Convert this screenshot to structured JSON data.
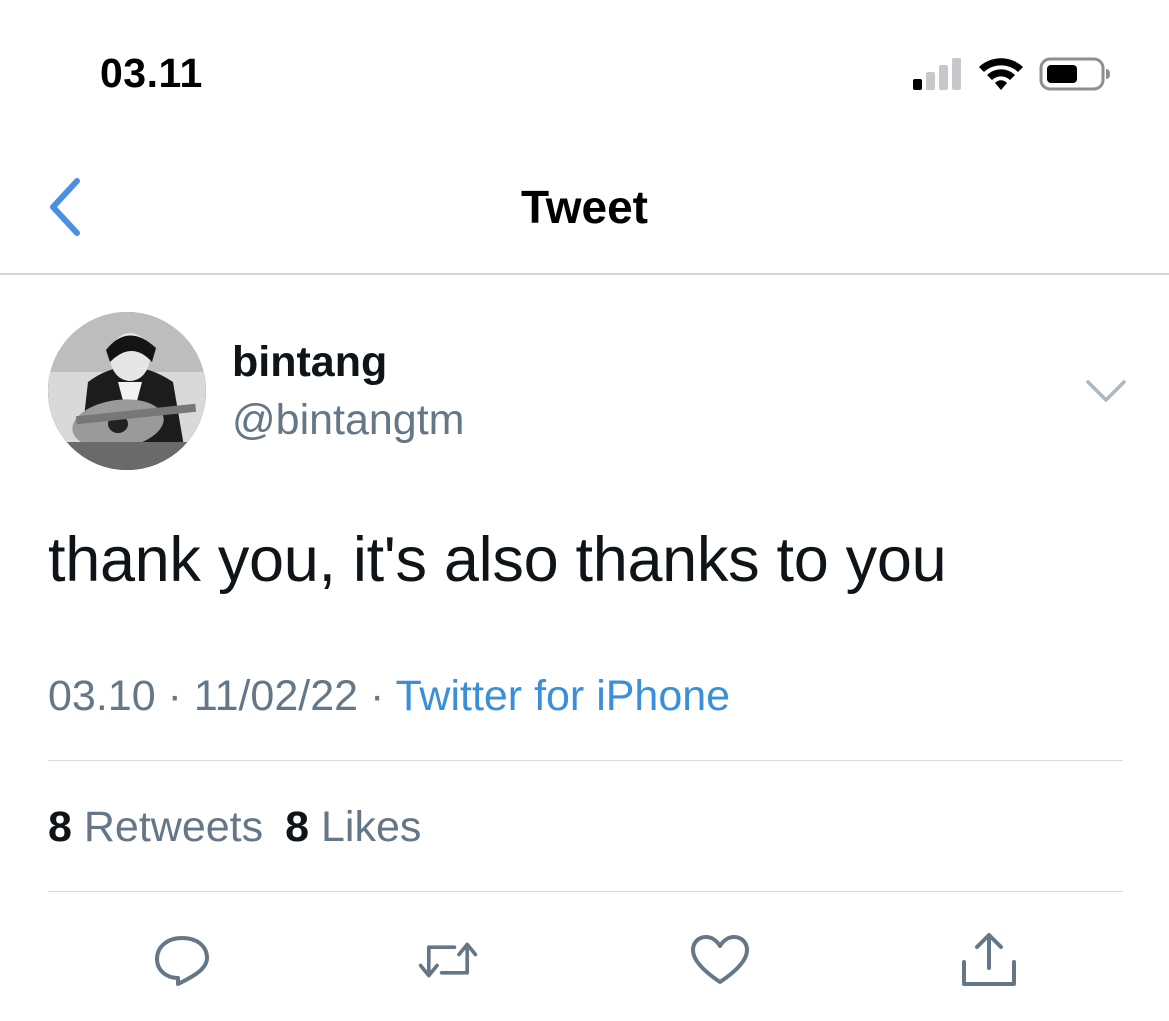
{
  "status_bar": {
    "time": "03.11"
  },
  "nav": {
    "title": "Tweet"
  },
  "author": {
    "name": "bintang",
    "handle": "@bintangtm"
  },
  "tweet": {
    "text": "thank you, it's also thanks to you",
    "time": "03.10",
    "date": "11/02/22",
    "separator": "·",
    "source": "Twitter for iPhone"
  },
  "stats": {
    "retweets_count": "8",
    "retweets_label": "Retweets",
    "likes_count": "8",
    "likes_label": "Likes"
  },
  "actions": [
    {
      "icon": "reply-icon"
    },
    {
      "icon": "retweet-icon"
    },
    {
      "icon": "like-icon"
    },
    {
      "icon": "share-icon"
    }
  ],
  "colors": {
    "accent": "#3b8fd9",
    "secondary_text": "#657786",
    "icon_gray": "#657786"
  }
}
